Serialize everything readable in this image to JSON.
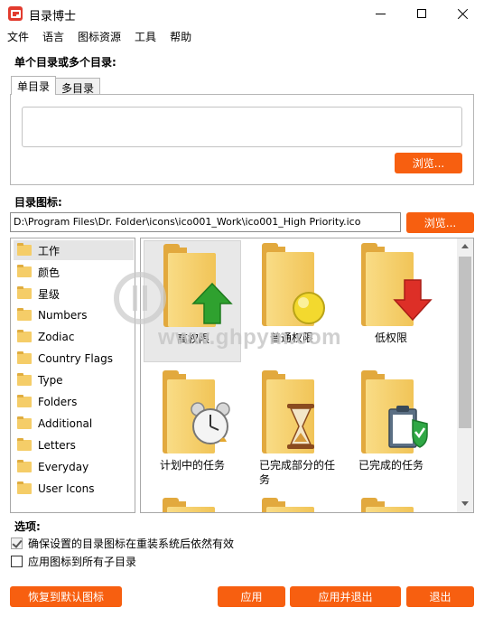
{
  "window": {
    "title": "目录博士"
  },
  "menu": [
    "文件",
    "语言",
    "图标资源",
    "工具",
    "帮助"
  ],
  "single_or_multi_label": "单个目录或多个目录:",
  "tabs": [
    "单目录",
    "多目录"
  ],
  "browse_label": "浏览...",
  "dir_icon_label": "目录图标:",
  "icon_path": "D:\\Program Files\\Dr. Folder\\icons\\ico001_Work\\ico001_High Priority.ico",
  "categories": [
    "工作",
    "颜色",
    "星级",
    "Numbers",
    "Zodiac",
    "Country Flags",
    "Type",
    "Folders",
    "Additional",
    "Letters",
    "Everyday",
    "User Icons"
  ],
  "icons": [
    "高权限",
    "普通权限",
    "低权限",
    "计划中的任务",
    "已完成部分的任务",
    "已完成的任务"
  ],
  "watermark": "www.ghpym.com",
  "options_label": "选项:",
  "options": [
    {
      "label": "确保设置的目录图标在重装系统后依然有效",
      "checked": true
    },
    {
      "label": "应用图标到所有子目录",
      "checked": false
    }
  ],
  "buttons": {
    "restore": "恢复到默认图标",
    "apply": "应用",
    "apply_exit": "应用并退出",
    "exit": "退出"
  },
  "colors": {
    "accent": "#f75f10",
    "folder": "#f5cd68"
  }
}
